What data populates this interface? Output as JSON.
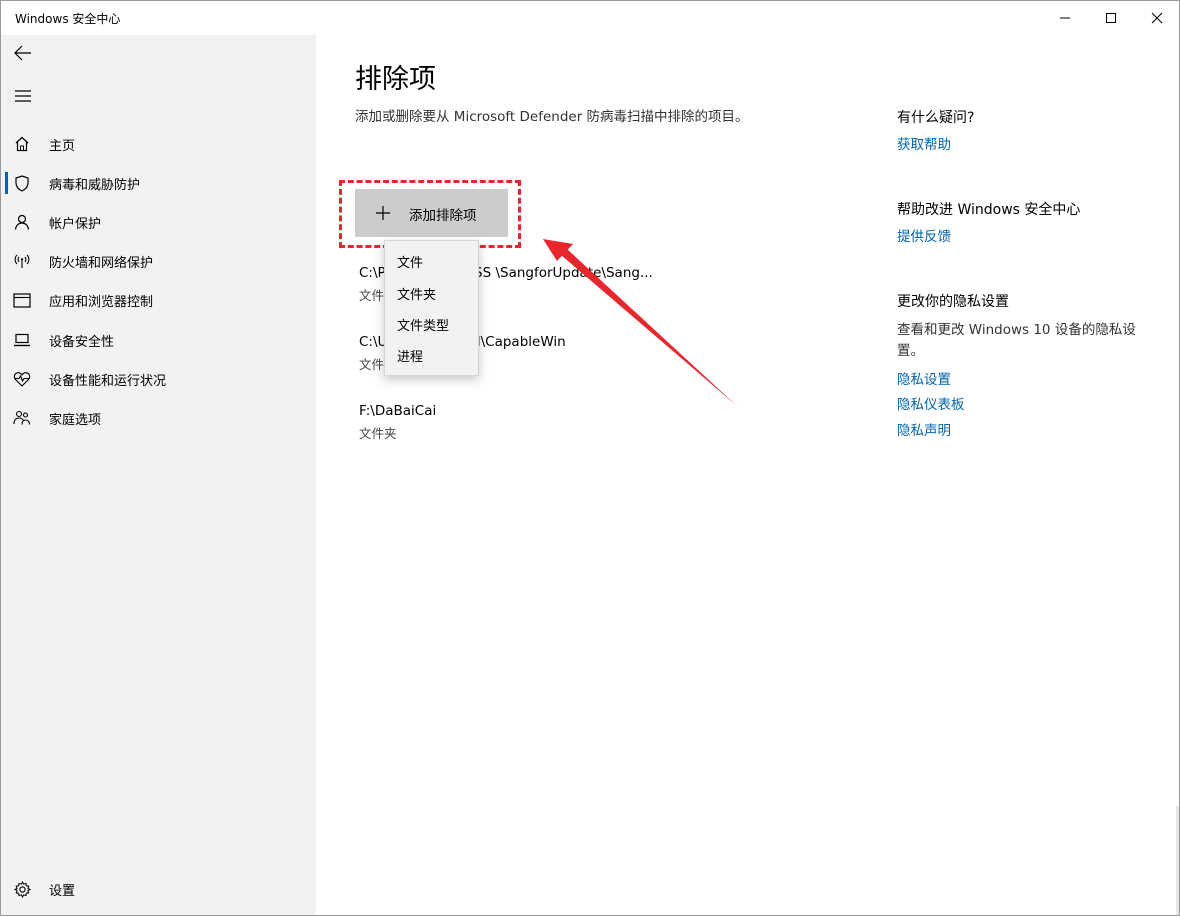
{
  "window": {
    "title": "Windows 安全中心"
  },
  "sidebar": {
    "items": [
      {
        "label": "主页",
        "icon": "home-icon"
      },
      {
        "label": "病毒和威胁防护",
        "icon": "shield-icon",
        "active": true
      },
      {
        "label": "帐户保护",
        "icon": "person-icon"
      },
      {
        "label": "防火墙和网络保护",
        "icon": "wifi-antenna-icon"
      },
      {
        "label": "应用和浏览器控制",
        "icon": "browser-window-icon"
      },
      {
        "label": "设备安全性",
        "icon": "laptop-icon"
      },
      {
        "label": "设备性能和运行状况",
        "icon": "heart-pulse-icon"
      },
      {
        "label": "家庭选项",
        "icon": "family-icon"
      }
    ],
    "settings_label": "设置"
  },
  "main": {
    "title": "排除项",
    "description": "添加或删除要从 Microsoft Defender 防病毒扫描中排除的项目。",
    "add_button_label": "添加排除项",
    "exclusions": [
      {
        "path": "C:\\P             86)\\Sangfor\\SS  \\SangforUpdate\\Sang...",
        "type": "文件"
      },
      {
        "path": "C:\\U                 ppData\\Local\\CapableWin",
        "type": "文件"
      },
      {
        "path": "F:\\DaBaiCai",
        "type": "文件夹"
      }
    ],
    "dropdown_options": [
      "文件",
      "文件夹",
      "文件类型",
      "进程"
    ]
  },
  "right_panel": {
    "help_heading": "有什么疑问?",
    "help_link": "获取帮助",
    "improve_heading": "帮助改进 Windows 安全中心",
    "feedback_link": "提供反馈",
    "privacy_heading": "更改你的隐私设置",
    "privacy_text": "查看和更改 Windows 10 设备的隐私设置。",
    "privacy_links": [
      "隐私设置",
      "隐私仪表板",
      "隐私声明"
    ]
  },
  "colors": {
    "accent": "#0063b1",
    "annotation_red": "#e8262c",
    "sidebar_bg": "#f2f2f2"
  }
}
